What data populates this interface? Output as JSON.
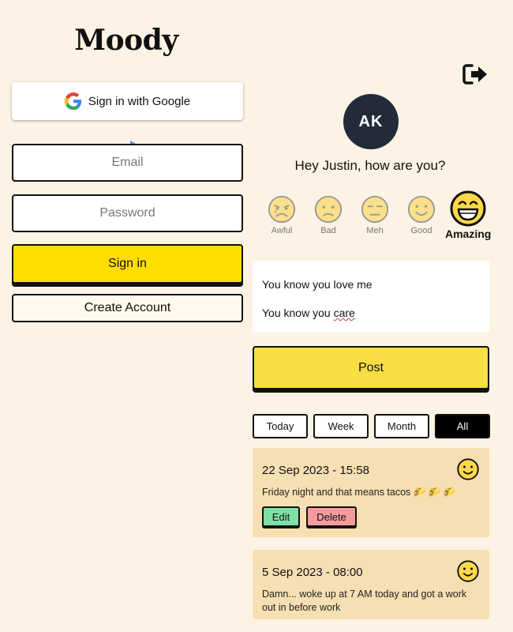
{
  "app": {
    "title": "Moody"
  },
  "login": {
    "google_label": "Sign in with Google",
    "email_placeholder": "Email",
    "password_placeholder": "Password",
    "signin_label": "Sign in",
    "create_label": "Create Account"
  },
  "user": {
    "initials": "AK",
    "greeting": "Hey Justin, how are you?"
  },
  "moods": [
    {
      "label": "Awful",
      "icon": "awful-face-icon"
    },
    {
      "label": "Bad",
      "icon": "bad-face-icon"
    },
    {
      "label": "Meh",
      "icon": "meh-face-icon"
    },
    {
      "label": "Good",
      "icon": "good-face-icon"
    },
    {
      "label": "Amazing",
      "icon": "amazing-face-icon",
      "selected": true
    }
  ],
  "entry": {
    "line1": "You know you love me",
    "line2_prefix": "You know you ",
    "line2_misspelled": "care"
  },
  "post_label": "Post",
  "filters": [
    {
      "label": "Today"
    },
    {
      "label": "Week"
    },
    {
      "label": "Month"
    },
    {
      "label": "All",
      "active": true
    }
  ],
  "posts": [
    {
      "date": "22 Sep 2023 - 15:58",
      "text": "Friday night and that means tacos 🌮 🌮 🌮",
      "edit_label": "Edit",
      "delete_label": "Delete",
      "mood_icon": "good-face-icon"
    },
    {
      "date": "5 Sep 2023 - 08:00",
      "text": "Damn... woke up at 7 AM today and got a work out in before work",
      "mood_icon": "good-face-icon"
    }
  ],
  "colors": {
    "background": "#fdf3e4",
    "primary_yellow": "#ffdd00",
    "post_yellow": "#f7de45",
    "card": "#f6dfb2",
    "edit_green": "#7fe0a6",
    "delete_red": "#f59b9b",
    "avatar": "#232b3a"
  }
}
